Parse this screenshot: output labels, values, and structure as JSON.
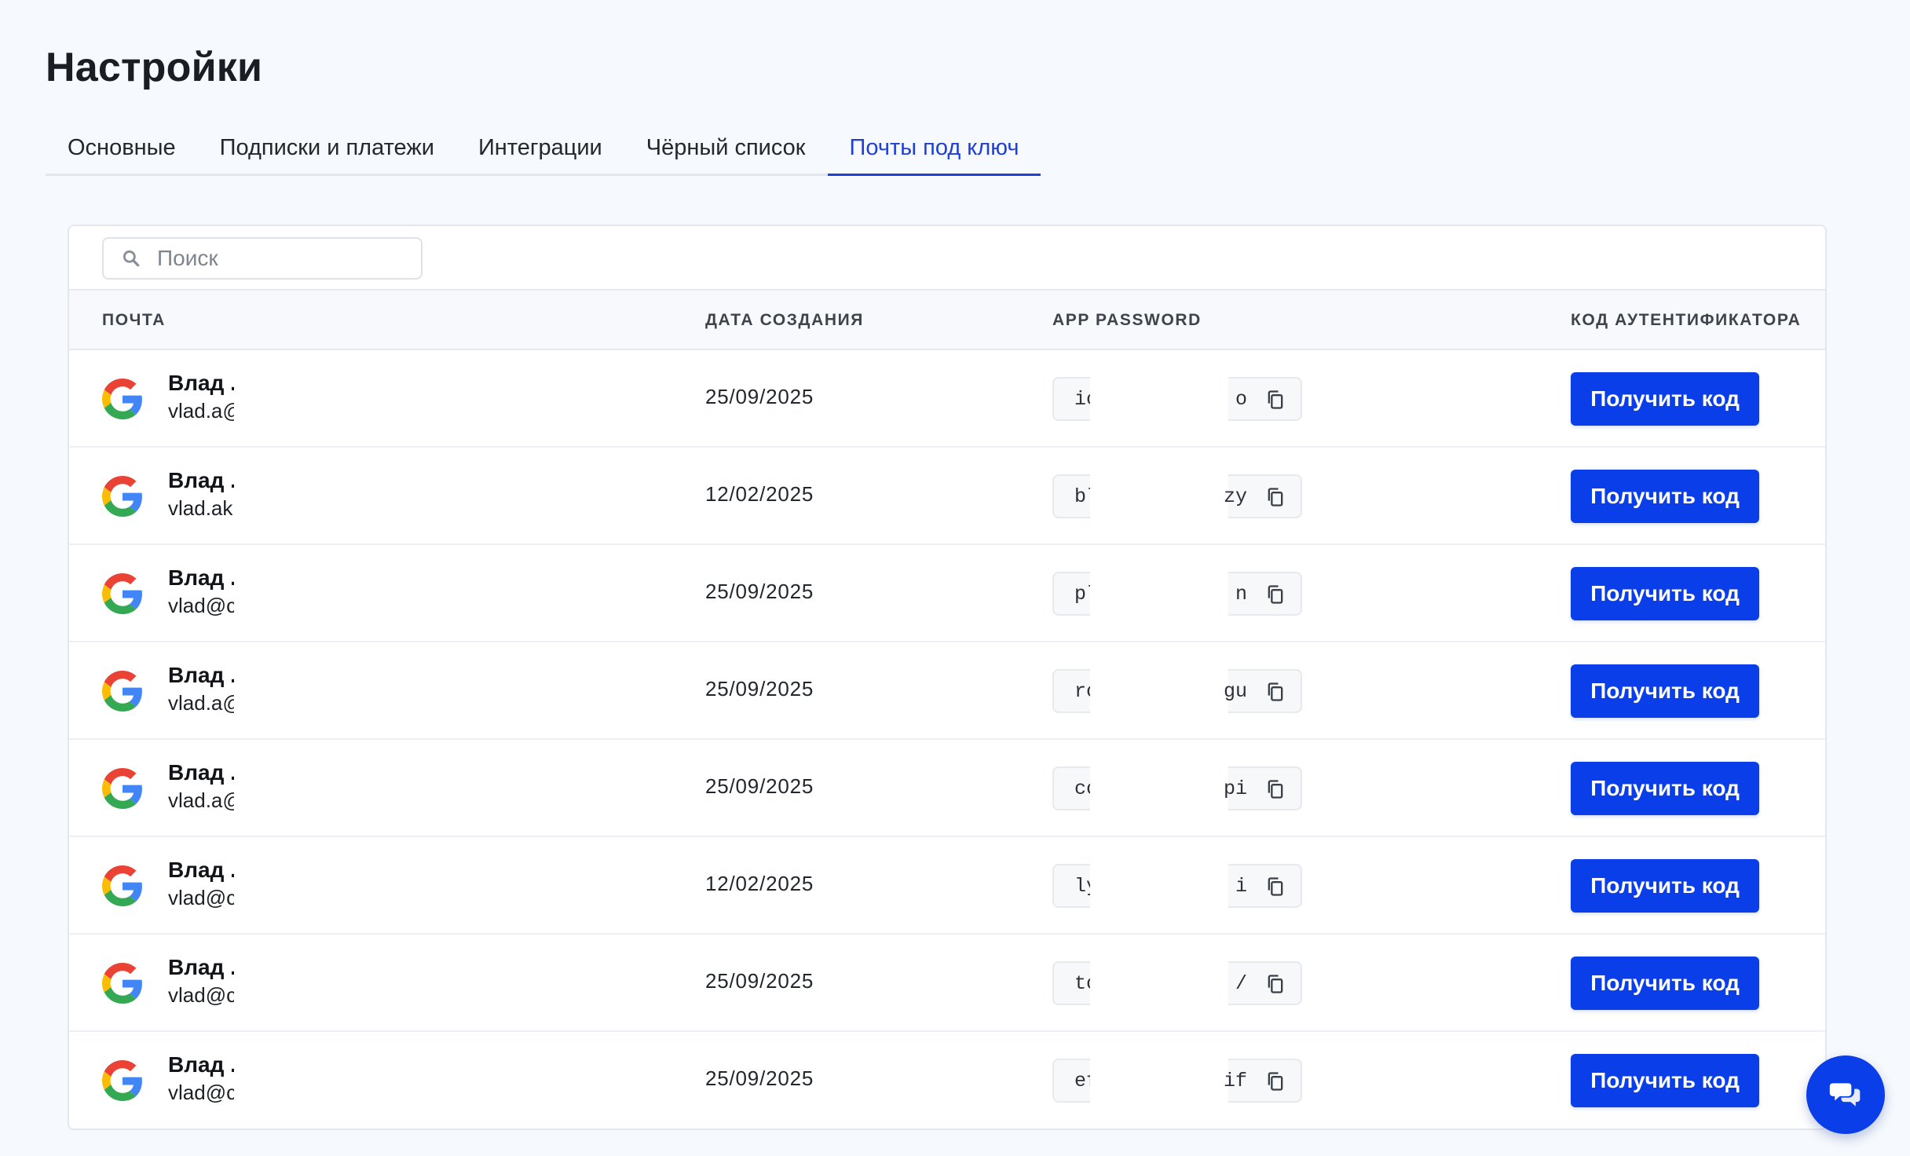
{
  "page": {
    "title": "Настройки"
  },
  "tabs": [
    {
      "label": "Основные"
    },
    {
      "label": "Подписки и платежи"
    },
    {
      "label": "Интеграции"
    },
    {
      "label": "Чёрный список"
    },
    {
      "label": "Почты под ключ"
    }
  ],
  "active_tab": "Почты под ключ",
  "search": {
    "placeholder": "Поиск",
    "value": "",
    "icon": "search-icon"
  },
  "table": {
    "columns": [
      "ПОЧТА",
      "ДАТА СОЗДАНИЯ",
      "APP PASSWORD",
      "КОД АУТЕНТИФИКАТОРА"
    ],
    "button_label": "Получить код",
    "rows": [
      {
        "provider_icon": "google-icon",
        "name": "Влад .",
        "email": "vlad.a@",
        "date": "25/09/2025",
        "pwd_start": "ic",
        "pwd_end": "o"
      },
      {
        "provider_icon": "google-icon",
        "name": "Влад .",
        "email": "vlad.ak",
        "date": "12/02/2025",
        "pwd_start": "bl",
        "pwd_end": "zy"
      },
      {
        "provider_icon": "google-icon",
        "name": "Влад .",
        "email": "vlad@c",
        "date": "25/09/2025",
        "pwd_start": "pl",
        "pwd_end": "n"
      },
      {
        "provider_icon": "google-icon",
        "name": "Влад .",
        "email": "vlad.a@",
        "date": "25/09/2025",
        "pwd_start": "ro",
        "pwd_end": "gu"
      },
      {
        "provider_icon": "google-icon",
        "name": "Влад .",
        "email": "vlad.a@",
        "date": "25/09/2025",
        "pwd_start": "co",
        "pwd_end": "pi"
      },
      {
        "provider_icon": "google-icon",
        "name": "Влад .",
        "email": "vlad@c",
        "date": "12/02/2025",
        "pwd_start": "ly",
        "pwd_end": "i"
      },
      {
        "provider_icon": "google-icon",
        "name": "Влад .",
        "email": "vlad@c",
        "date": "25/09/2025",
        "pwd_start": "to",
        "pwd_end": "/"
      },
      {
        "provider_icon": "google-icon",
        "name": "Влад .",
        "email": "vlad@c",
        "date": "25/09/2025",
        "pwd_start": "ef",
        "pwd_end": "if"
      }
    ]
  },
  "chat_widget": {
    "icon": "chat-icon"
  },
  "colors": {
    "accent": "#0a3ee8",
    "active_tab": "#1f3fd6",
    "background": "#f6f9fd"
  }
}
